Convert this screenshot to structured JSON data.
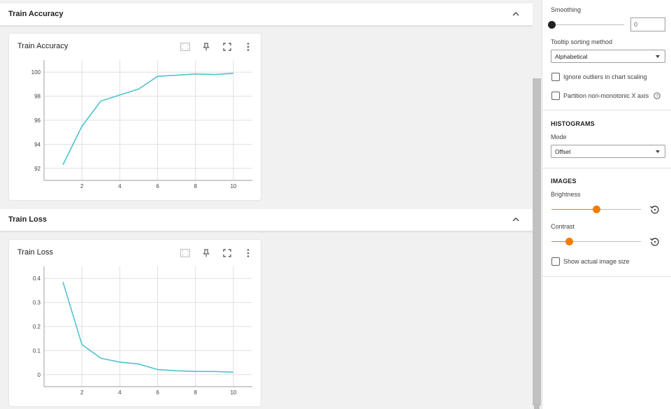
{
  "groups": [
    {
      "title": "Train Accuracy",
      "card_title": "Train Accuracy"
    },
    {
      "title": "Train Loss",
      "card_title": "Train Loss"
    }
  ],
  "tool_icons": [
    "fit-domain-icon",
    "pin-icon",
    "fullscreen-icon",
    "more-vert-icon"
  ],
  "settings": {
    "smoothing_label": "Smoothing",
    "smoothing_value": "0",
    "smoothing_level": 0,
    "tooltip_label": "Tooltip sorting method",
    "tooltip_value": "Alphabetical",
    "ignore_outliers_label": "Ignore outliers in chart scaling",
    "ignore_outliers_checked": false,
    "partition_label": "Partition non-monotonic X axis",
    "partition_checked": true
  },
  "histograms": {
    "title": "HISTOGRAMS",
    "mode_label": "Mode",
    "mode_value": "Offset"
  },
  "images": {
    "title": "IMAGES",
    "brightness_label": "Brightness",
    "brightness_level": 0.5,
    "contrast_label": "Contrast",
    "contrast_level": 0.2,
    "actual_size_label": "Show actual image size",
    "actual_size_checked": false
  },
  "colors": {
    "series": "#4fc3cf",
    "accent": "#f57c00",
    "grid": "#e0e0e0"
  },
  "chart_data": [
    {
      "type": "line",
      "title": "Train Accuracy",
      "x": [
        1,
        2,
        3,
        4,
        5,
        6,
        7,
        8,
        9,
        10
      ],
      "series": [
        {
          "values": [
            92.3,
            95.5,
            97.6,
            98.1,
            98.6,
            99.65,
            99.75,
            99.85,
            99.8,
            99.9
          ]
        }
      ],
      "xlim": [
        0,
        11
      ],
      "ylim": [
        91,
        101
      ],
      "xticks": [
        "2",
        "4",
        "6",
        "8",
        "10"
      ],
      "yticks": [
        "92",
        "94",
        "96",
        "98",
        "100"
      ],
      "grid": true
    },
    {
      "type": "line",
      "title": "Train Loss",
      "x": [
        1,
        2,
        3,
        4,
        5,
        6,
        7,
        8,
        9,
        10
      ],
      "series": [
        {
          "values": [
            0.385,
            0.125,
            0.068,
            0.052,
            0.044,
            0.021,
            0.016,
            0.013,
            0.013,
            0.01
          ]
        }
      ],
      "xlim": [
        0,
        11
      ],
      "ylim": [
        -0.05,
        0.45
      ],
      "xticks": [
        "2",
        "4",
        "6",
        "8",
        "10"
      ],
      "yticks": [
        "0",
        "0.1",
        "0.2",
        "0.3",
        "0.4"
      ],
      "grid": true
    }
  ]
}
